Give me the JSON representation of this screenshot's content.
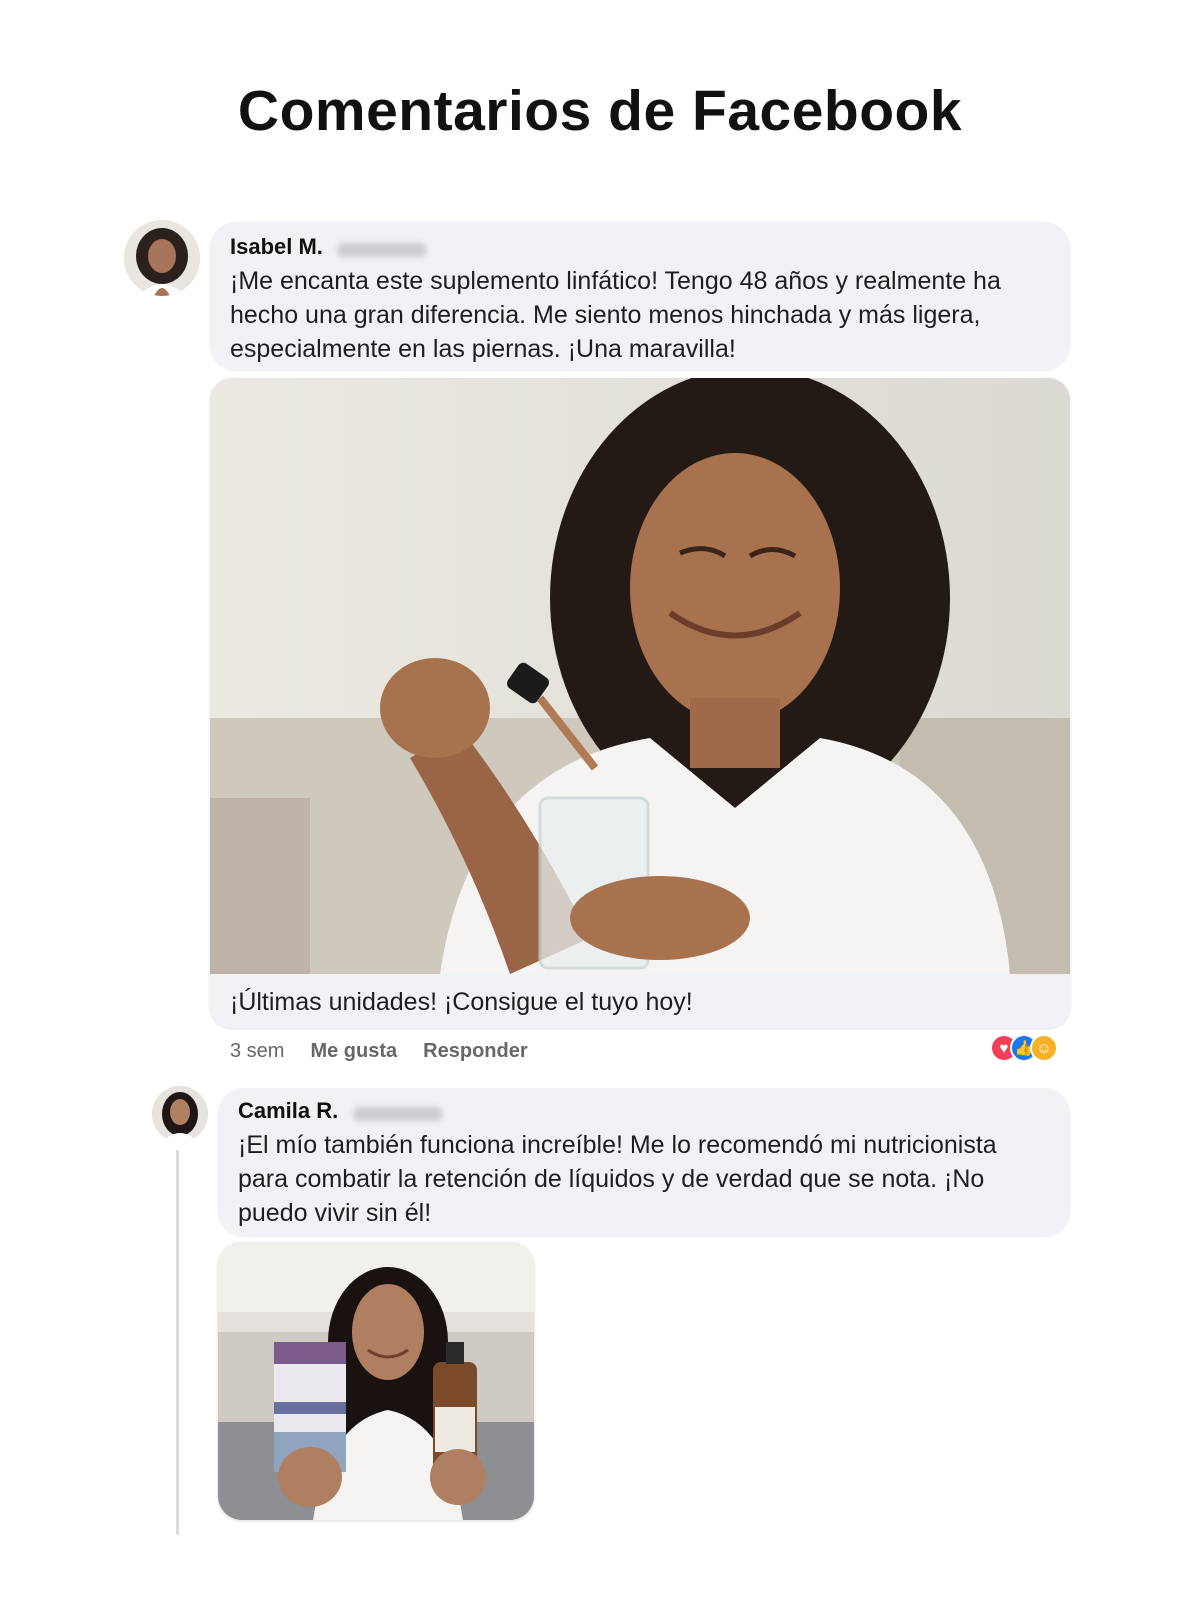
{
  "page": {
    "title": "Comentarios de Facebook"
  },
  "comment": {
    "author": "Isabel M.",
    "text": "¡Me encanta este suplemento linfático! Tengo 48 años y realmente ha hecho una gran diferencia. Me siento menos hinchada y más ligera, especialmente en las piernas. ¡Una maravilla!",
    "caption": "¡Últimas unidades! ¡Consigue el tuyo hoy!",
    "time": "3 sem",
    "like_label": "Me gusta",
    "reply_label": "Responder",
    "reactions": [
      "heart-reaction-icon",
      "like-reaction-icon",
      "care-reaction-icon"
    ]
  },
  "reply": {
    "author": "Camila R.",
    "text": "¡El mío también funciona increíble! Me lo recomendó mi nutricionista para combatir la retención de líquidos y de verdad que se nota. ¡No puedo vivir sin él!"
  },
  "colors": {
    "bubble": "#f0f2f5",
    "meta_text": "#65676b",
    "heart": "#f33e58",
    "like": "#1877f2",
    "care": "#f7b125"
  }
}
